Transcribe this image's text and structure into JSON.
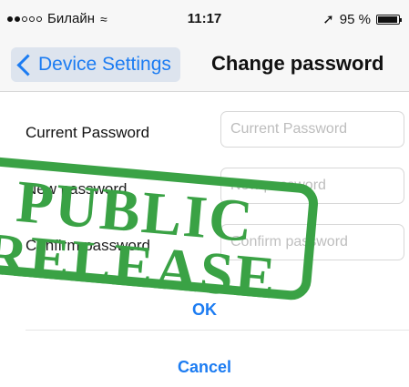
{
  "status_bar": {
    "carrier": "Билайн",
    "time": "11:17",
    "battery_text": "95 %"
  },
  "nav": {
    "back_label": "Device Settings",
    "title": "Change password"
  },
  "form": {
    "fields": [
      {
        "label": "Current Password",
        "placeholder": "Current Password"
      },
      {
        "label": "New password",
        "placeholder": "New password"
      },
      {
        "label": "Confirm password",
        "placeholder": "Confirm password"
      }
    ]
  },
  "actions": {
    "ok": "OK",
    "cancel": "Cancel"
  },
  "stamp": {
    "line1": "PUBLIC",
    "line2": "RELEASE",
    "color": "#3aa245"
  },
  "colors": {
    "accent": "#1c7cf2"
  }
}
